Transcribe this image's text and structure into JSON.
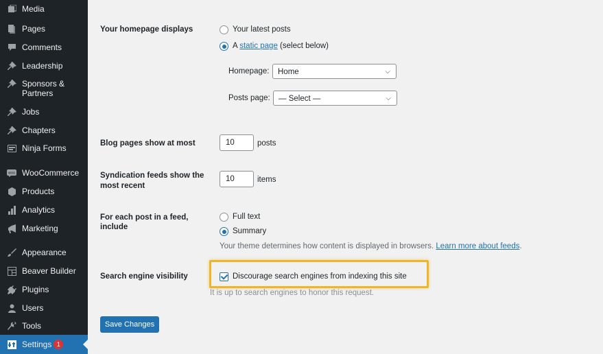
{
  "sidebar": {
    "items": [
      {
        "label": "Media",
        "icon": "media-icon"
      },
      {
        "label": "Pages",
        "icon": "pages-icon"
      },
      {
        "label": "Comments",
        "icon": "comments-icon"
      },
      {
        "label": "Leadership",
        "icon": "pin-icon"
      },
      {
        "label": "Sponsors &",
        "label2": "Partners",
        "icon": "pin-icon"
      },
      {
        "label": "Jobs",
        "icon": "pin-icon"
      },
      {
        "label": "Chapters",
        "icon": "pin-icon"
      },
      {
        "label": "Ninja Forms",
        "icon": "forms-icon"
      },
      {
        "label": "WooCommerce",
        "icon": "woo-icon"
      },
      {
        "label": "Products",
        "icon": "products-icon"
      },
      {
        "label": "Analytics",
        "icon": "analytics-icon"
      },
      {
        "label": "Marketing",
        "icon": "marketing-icon"
      },
      {
        "label": "Appearance",
        "icon": "appearance-icon"
      },
      {
        "label": "Beaver Builder",
        "icon": "builder-icon"
      },
      {
        "label": "Plugins",
        "icon": "plugins-icon"
      },
      {
        "label": "Users",
        "icon": "users-icon"
      },
      {
        "label": "Tools",
        "icon": "tools-icon"
      },
      {
        "label": "Settings",
        "icon": "settings-icon",
        "badge": "1",
        "active": true
      }
    ]
  },
  "reading": {
    "homepage_label": "Your homepage displays",
    "opt_latest": "Your latest posts",
    "opt_static_prefix": "A ",
    "opt_static_link": "static page",
    "opt_static_suffix": " (select below)",
    "homepage_select_label": "Homepage:",
    "homepage_select_value": "Home",
    "posts_select_label": "Posts page:",
    "posts_select_value": "— Select —",
    "blog_label": "Blog pages show at most",
    "blog_value": "10",
    "blog_unit": "posts",
    "synd_label_1": "Syndication feeds show the",
    "synd_label_2": "most recent",
    "synd_value": "10",
    "synd_unit": "items",
    "feed_label_1": "For each post in a feed,",
    "feed_label_2": "include",
    "feed_full": "Full text",
    "feed_summary": "Summary",
    "feed_desc": "Your theme determines how content is displayed in browsers. ",
    "feed_desc_link": "Learn more about feeds",
    "feed_desc_end": ".",
    "search_label": "Search engine visibility",
    "search_checkbox": "Discourage search engines from indexing this site",
    "search_desc": "It is up to search engines to honor this request.",
    "save_button": "Save Changes"
  },
  "colors": {
    "sidebar_bg": "#1d2327",
    "accent": "#2271b1",
    "highlight": "#f0b429",
    "badge": "#d63638"
  }
}
